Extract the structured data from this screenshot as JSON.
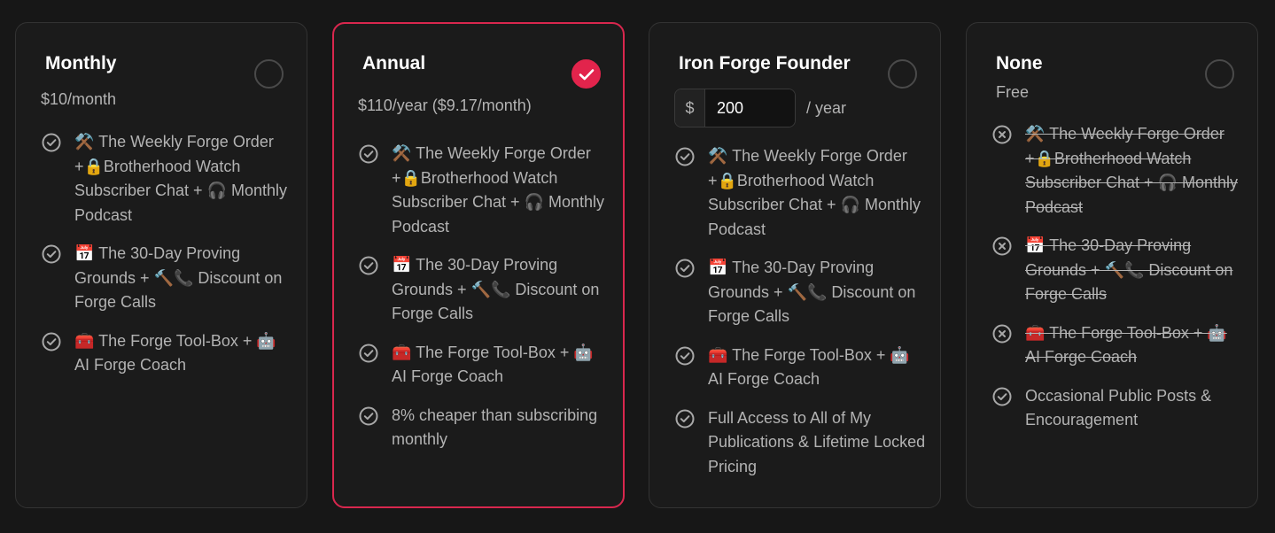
{
  "plans": [
    {
      "id": "monthly",
      "title": "Monthly",
      "price": "$10/month",
      "selected": false,
      "features": [
        {
          "text": "⚒️ The Weekly Forge Order +🔒Brotherhood Watch Subscriber Chat + 🎧 Monthly Podcast",
          "included": true
        },
        {
          "text": "📅 The 30-Day Proving Grounds + 🔨📞 Discount on Forge Calls",
          "included": true
        },
        {
          "text": "🧰 The Forge Tool-Box + 🤖 AI Forge Coach",
          "included": true
        }
      ]
    },
    {
      "id": "annual",
      "title": "Annual",
      "price": "$110/year ($9.17/month)",
      "selected": true,
      "features": [
        {
          "text": "⚒️ The Weekly Forge Order +🔒Brotherhood Watch Subscriber Chat + 🎧 Monthly Podcast",
          "included": true
        },
        {
          "text": "📅 The 30-Day Proving Grounds + 🔨📞 Discount on Forge Calls",
          "included": true
        },
        {
          "text": "🧰 The Forge Tool-Box + 🤖 AI Forge Coach",
          "included": true
        },
        {
          "text": "8% cheaper than subscribing monthly",
          "included": true
        }
      ]
    },
    {
      "id": "founder",
      "title": "Iron Forge Founder",
      "currency_symbol": "$",
      "amount_value": "200",
      "amount_suffix": "/ year",
      "selected": false,
      "features": [
        {
          "text": "⚒️ The Weekly Forge Order +🔒Brotherhood Watch Subscriber Chat + 🎧 Monthly Podcast",
          "included": true
        },
        {
          "text": "📅 The 30-Day Proving Grounds + 🔨📞 Discount on Forge Calls",
          "included": true
        },
        {
          "text": "🧰 The Forge Tool-Box + 🤖 AI Forge Coach",
          "included": true
        },
        {
          "text": "Full Access to All of My Publications & Lifetime Locked Pricing",
          "included": true
        }
      ]
    },
    {
      "id": "none",
      "title": "None",
      "price": "Free",
      "selected": false,
      "features": [
        {
          "text": "⚒️ The Weekly Forge Order +🔒Brotherhood Watch Subscriber Chat + 🎧 Monthly Podcast",
          "included": false
        },
        {
          "text": "📅 The 30-Day Proving Grounds + 🔨📞 Discount on Forge Calls",
          "included": false
        },
        {
          "text": "🧰 The Forge Tool-Box + 🤖 AI Forge Coach",
          "included": false
        },
        {
          "text": "Occasional Public Posts & Encouragement",
          "included": true
        }
      ]
    }
  ],
  "icons": {
    "included": "check-circle-icon",
    "excluded": "x-circle-icon",
    "selected": "checkmark-icon"
  },
  "colors": {
    "accent": "#e2244c",
    "background": "#171717",
    "card": "#1b1b1b",
    "border": "#333333",
    "text": "#b3b3b3",
    "title": "#ffffff"
  }
}
